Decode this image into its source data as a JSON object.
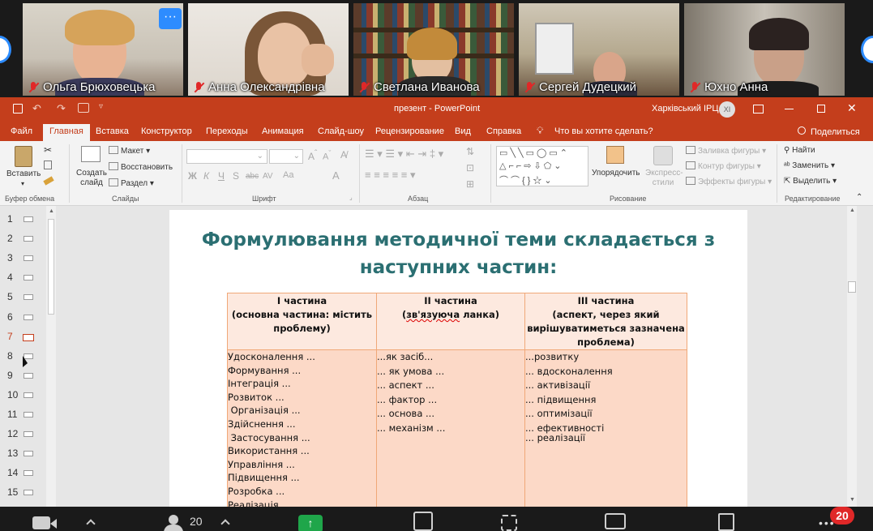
{
  "gallery": {
    "participants": [
      {
        "name": "Ольга Брюховецька",
        "muted": true
      },
      {
        "name": "Анна Олександрівна",
        "muted": true
      },
      {
        "name": "Светлана Иванова",
        "muted": true
      },
      {
        "name": "Сергей Дудецкий",
        "muted": true
      },
      {
        "name": "Юхно Анна",
        "muted": true
      }
    ],
    "more_label": "···"
  },
  "ppt": {
    "doc_title": "презент - PowerPoint",
    "org": "Харківський ІРЦ",
    "user_initials": "XI",
    "tabs": [
      "Файл",
      "Главная",
      "Вставка",
      "Конструктор",
      "Переходы",
      "Анимация",
      "Слайд-шоу",
      "Рецензирование",
      "Вид",
      "Справка"
    ],
    "active_tab": "Главная",
    "tell_me": "Что вы хотите сделать?",
    "share": "Поделиться",
    "ribbon": {
      "paste": "Вставить",
      "clipboard": "Буфер обмена",
      "new_slide": "Создать слайд",
      "layout": "Макет",
      "reset": "Восстановить",
      "section": "Раздел",
      "slides": "Слайды",
      "font": "Шрифт",
      "paragraph": "Абзац",
      "arrange": "Упорядочить",
      "quick_styles": "Экспресс-стили",
      "shape_fill": "Заливка фигуры",
      "shape_outline": "Контур фигуры",
      "shape_effects": "Эффекты фигуры",
      "drawing": "Рисование",
      "find": "Найти",
      "replace": "Заменить",
      "select": "Выделить",
      "editing": "Редактирование",
      "font_buttons": [
        "Ж",
        "К",
        "Ч",
        "S",
        "abc",
        "AV",
        "Aa",
        "A"
      ]
    },
    "thumb_numbers": [
      "1",
      "2",
      "3",
      "4",
      "5",
      "6",
      "7",
      "8",
      "9",
      "10",
      "11",
      "12",
      "13",
      "14",
      "15"
    ],
    "slide": {
      "title_line1": "Формулювання методичної теми складається з",
      "title_line2": "наступних частин:",
      "col1_header": [
        "I частина",
        "(основна частина: містить",
        "проблему)"
      ],
      "col2_header_a": "II частина",
      "col2_header_b_pre": "(",
      "col2_header_b_sq": "зв'язуюча",
      "col2_header_b_post": " ланка)",
      "col3_header": [
        "III частина",
        "(аспект, через який",
        "вирішуватиметься зазначена",
        "проблема)"
      ],
      "col1_items": [
        "Удосконалення ...",
        "Формування ...",
        "Інтеграція ...",
        "Розвиток ...",
        " Організація ...",
        "Здійснення ...",
        " Застосування ...",
        "Використання ...",
        "Управління ...",
        "Підвищення ...",
        "Розробка ...",
        "Реалізація ..."
      ],
      "col2_items": [
        "...як засіб...",
        "... як умова ...",
        "... аспект ...",
        "... фактор ...",
        "... основа ...",
        "... механізм ..."
      ],
      "col3_items": [
        "...розвитку",
        "... вдосконалення",
        "... активізації",
        "... підвищення",
        "... оптимізації",
        "... ефективності",
        "... реалізації"
      ]
    }
  },
  "zoom": {
    "participants_count": "20",
    "chat_badge": "20"
  }
}
